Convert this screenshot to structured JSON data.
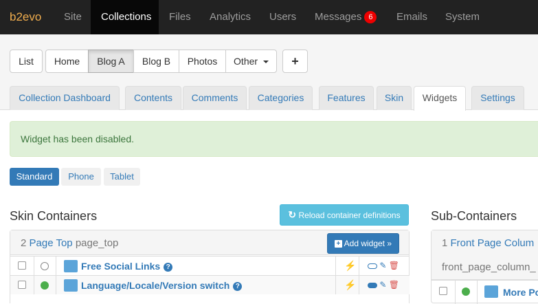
{
  "topbar": {
    "logo": "b2evo",
    "items": [
      "Site",
      "Collections",
      "Files",
      "Analytics",
      "Users",
      "Messages",
      "Emails",
      "System"
    ],
    "messages_badge": "6"
  },
  "collections": {
    "list_label": "List",
    "blogs": [
      "Home",
      "Blog A",
      "Blog B",
      "Photos",
      "Other"
    ],
    "add_label": "+"
  },
  "tabs": [
    "Collection Dashboard",
    "Contents",
    "Comments",
    "Categories",
    "Features",
    "Skin",
    "Widgets",
    "Settings"
  ],
  "alert": "Widget has been disabled.",
  "modes": [
    "Standard",
    "Phone",
    "Tablet"
  ],
  "skin_containers": {
    "title": "Skin Containers",
    "reload_label": "Reload container definitions",
    "container": {
      "count": "2",
      "name": "Page Top",
      "code": "page_top",
      "add_widget_label": "Add widget »",
      "widgets": [
        {
          "name": "Free Social Links",
          "enabled": false
        },
        {
          "name": "Language/Locale/Version switch",
          "enabled": true
        }
      ]
    }
  },
  "sub_containers": {
    "title": "Sub-Containers",
    "container": {
      "count": "1",
      "name": "Front Page Colum",
      "code": "front_page_column_",
      "widgets": [
        {
          "name": "More Po"
        }
      ]
    }
  },
  "colors": {
    "accent": "#337ab7",
    "enabled": "#4cae4c",
    "bolt": "#f0ad4e",
    "delete": "#d9534f"
  }
}
